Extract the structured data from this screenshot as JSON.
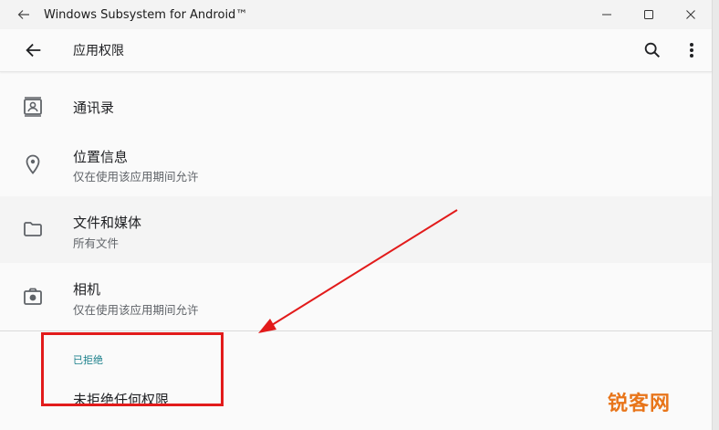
{
  "window": {
    "title": "Windows Subsystem for Android™"
  },
  "appbar": {
    "title": "应用权限"
  },
  "permissions": [
    {
      "name": "通讯录",
      "subtitle": "",
      "icon": "contacts-icon"
    },
    {
      "name": "位置信息",
      "subtitle": "仅在使用该应用期间允许",
      "icon": "location-pin-icon"
    },
    {
      "name": "文件和媒体",
      "subtitle": "所有文件",
      "icon": "folder-icon"
    },
    {
      "name": "相机",
      "subtitle": "仅在使用该应用期间允许",
      "icon": "camera-icon"
    }
  ],
  "denied": {
    "header": "已拒绝",
    "none_text": "未拒绝任何权限"
  },
  "annotation": {
    "box_color": "#e21b1b",
    "arrow_color": "#e21b1b"
  },
  "watermark": "锐客网"
}
